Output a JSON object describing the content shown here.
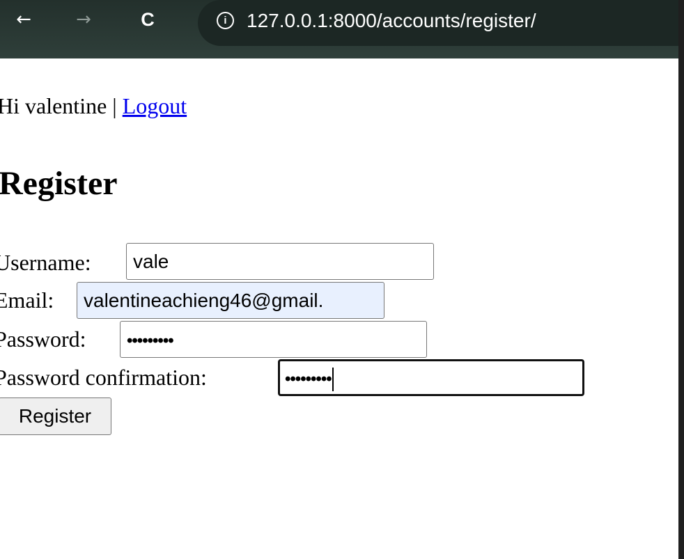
{
  "browser": {
    "url": "127.0.0.1:8000/accounts/register/",
    "back_icon": "←",
    "forward_icon": "→",
    "reload_icon": "C",
    "info_icon": "i"
  },
  "header": {
    "greeting": "Hi valentine",
    "separator": " | ",
    "logout_label": "Logout"
  },
  "page": {
    "title": "Register"
  },
  "form": {
    "username_label": "Username:",
    "username_value": "vale",
    "email_label": "Email:",
    "email_value": "valentineachieng46@gmail.",
    "password_label": "Password:",
    "password_value": "•••••••••",
    "password_confirmation_label": "Password confirmation:",
    "password_confirmation_value": "•••••••••",
    "submit_label": "Register"
  }
}
